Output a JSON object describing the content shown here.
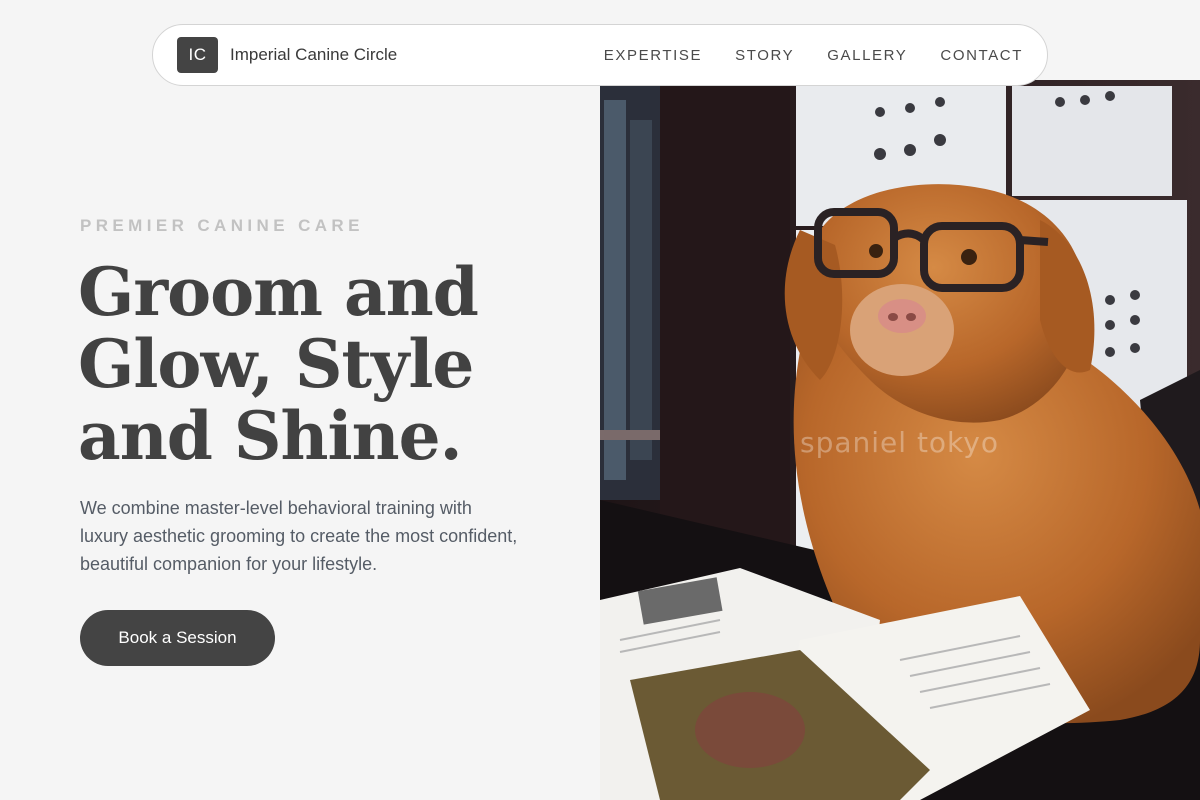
{
  "nav": {
    "logo_initials": "IC",
    "brand_name": "Imperial Canine Circle",
    "links": [
      "EXPERTISE",
      "STORY",
      "GALLERY",
      "CONTACT"
    ]
  },
  "hero": {
    "eyebrow": "PREMIER CANINE CARE",
    "headline_lines": [
      "Groom and",
      "Glow, Style",
      "and Shine."
    ],
    "lede": "We combine master-level behavioral training with luxury aesthetic grooming to create the most confident, beautiful companion for your lifestyle.",
    "cta_label": "Book a Session"
  },
  "photo": {
    "subject": "golden retriever wearing glasses beside an open magazine",
    "watermark": "spaniel tokyo"
  },
  "colors": {
    "page_bg": "#f5f5f5",
    "dark": "#444444",
    "eyebrow": "#c2c2c2",
    "body_text": "#555c66",
    "dog_fur": "#b8672a"
  }
}
